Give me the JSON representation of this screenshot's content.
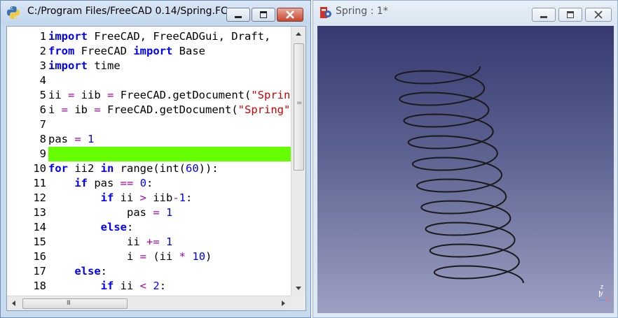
{
  "editor_window": {
    "title": "C:/Program Files/FreeCAD 0.14/Spring.FC...",
    "icon": "python-icon",
    "buttons": [
      "minimize-icon",
      "maximize-icon",
      "close-icon"
    ],
    "highlight_color": "#66ff00",
    "lines": [
      {
        "n": "1",
        "html": "<span class=\"kw\">import</span> FreeCAD, FreeCADGui, Draft,"
      },
      {
        "n": "2",
        "html": "<span class=\"kw\">from</span> FreeCAD <span class=\"kw\">import</span> Base"
      },
      {
        "n": "3",
        "html": "<span class=\"kw\">import</span> time"
      },
      {
        "n": "4",
        "html": ""
      },
      {
        "n": "5",
        "html": "ii <span class=\"op\">=</span> iib <span class=\"op\">=</span> FreeCAD.getDocument(<span class=\"str\">\"Spring\"</span>)"
      },
      {
        "n": "6",
        "html": "i <span class=\"op\">=</span> ib <span class=\"op\">=</span> FreeCAD.getDocument(<span class=\"str\">\"Spring\"</span>)"
      },
      {
        "n": "7",
        "html": ""
      },
      {
        "n": "8",
        "html": "pas <span class=\"op\">=</span> <span class=\"num\">1</span>"
      },
      {
        "n": "9",
        "html": "",
        "highlight": true
      },
      {
        "n": "10",
        "html": "<span class=\"kw\">for</span> ii2 <span class=\"kw\">in</span> range(int(<span class=\"num\">60</span>)):"
      },
      {
        "n": "11",
        "html": "    <span class=\"kw\">if</span> pas <span class=\"op\">==</span> <span class=\"num\">0</span>:"
      },
      {
        "n": "12",
        "html": "        <span class=\"kw\">if</span> ii <span class=\"op\">&gt;</span> iib<span class=\"op\">-</span><span class=\"num\">1</span>:"
      },
      {
        "n": "13",
        "html": "            pas <span class=\"op\">=</span> <span class=\"num\">1</span>"
      },
      {
        "n": "14",
        "html": "        <span class=\"kw\">else</span>:"
      },
      {
        "n": "15",
        "html": "            ii <span class=\"op\">+=</span> <span class=\"num\">1</span>"
      },
      {
        "n": "16",
        "html": "            i <span class=\"op\">=</span> (ii <span class=\"op\">*</span> <span class=\"num\">10</span>)"
      },
      {
        "n": "17",
        "html": "    <span class=\"kw\">else</span>:"
      },
      {
        "n": "18",
        "html": "        <span class=\"kw\">if</span> ii <span class=\"op\">&lt;</span> <span class=\"num\">2</span>:"
      }
    ],
    "scrollbar": {
      "vertical_grip": "=",
      "horizontal_grip": "III"
    }
  },
  "viewer_window": {
    "title": "Spring : 1*",
    "icon": "freecad-icon",
    "buttons": [
      "minimize-icon",
      "maximize-icon",
      "close-icon"
    ],
    "background_top": "#353970",
    "background_bottom": "#9da0c3",
    "helix_color": "#1a1a1a",
    "helix_turns": 10,
    "axis_labels": {
      "z": "z",
      "y": "y",
      "x": "x"
    }
  }
}
